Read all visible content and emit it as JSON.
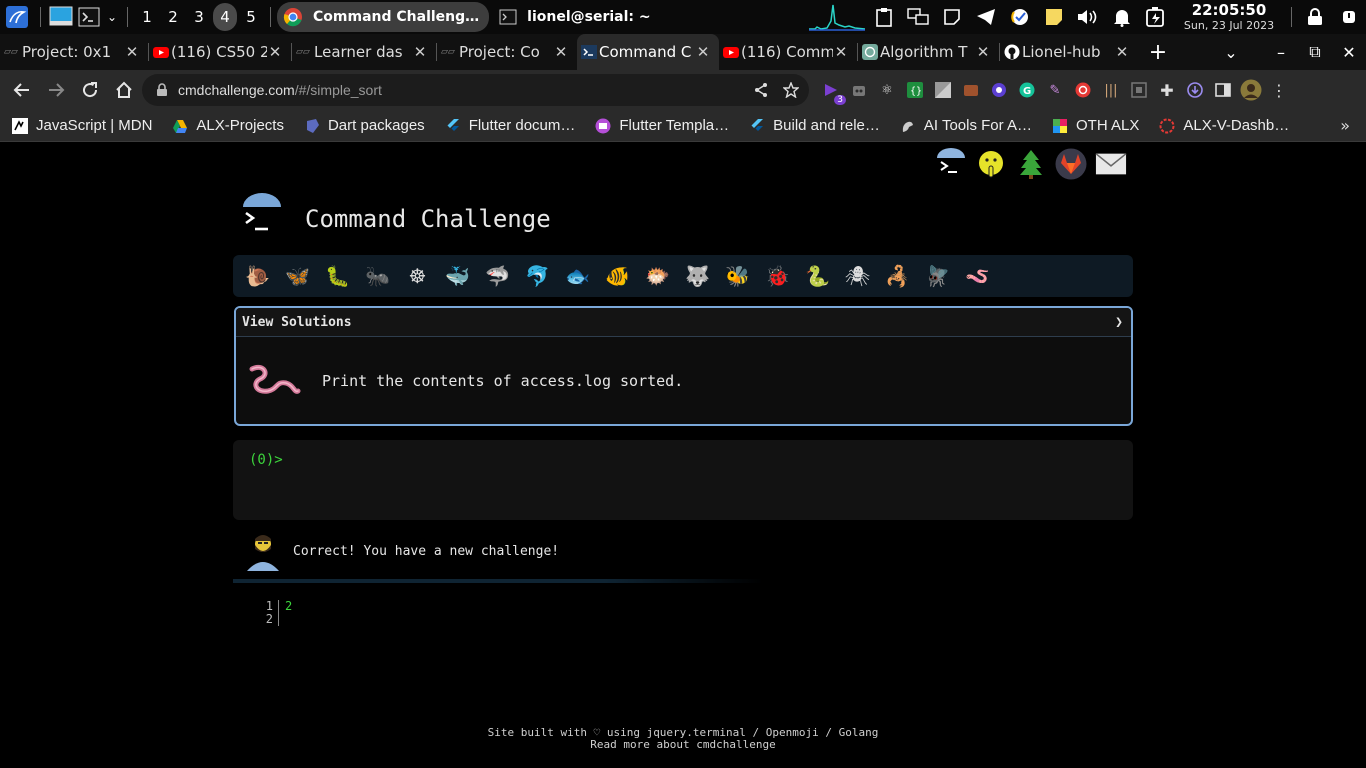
{
  "taskbar": {
    "workspaces": [
      "1",
      "2",
      "3",
      "4",
      "5"
    ],
    "active_workspace": "4",
    "apps": [
      {
        "label": "Command Challeng…",
        "icon": "chrome-icon"
      },
      {
        "label": "lionel@serial: ~",
        "icon": "terminal-icon"
      }
    ],
    "clock_time": "22:05:50",
    "clock_date": "Sun, 23 Jul 2023"
  },
  "tabs": [
    {
      "title": "Project: 0x1",
      "icon": "alx-icon"
    },
    {
      "title": "(116) CS50 2",
      "icon": "youtube-icon"
    },
    {
      "title": "Learner das",
      "icon": "alx-icon"
    },
    {
      "title": "Project: Co",
      "icon": "alx-icon"
    },
    {
      "title": "Command C",
      "icon": "terminal-icon"
    },
    {
      "title": "(116) Comm",
      "icon": "youtube-icon"
    },
    {
      "title": "Algorithm T",
      "icon": "openai-icon"
    },
    {
      "title": "Lionel-hub",
      "icon": "github-icon"
    }
  ],
  "address": {
    "host": "cmdchallenge.com",
    "path": "/#/simple_sort",
    "extension_badge": "3"
  },
  "bookmarks": [
    {
      "label": "JavaScript | MDN",
      "color": "#ffffff"
    },
    {
      "label": "ALX-Projects",
      "color": "#f4b400"
    },
    {
      "label": "Dart packages",
      "color": "#5c6bc0"
    },
    {
      "label": "Flutter docum…",
      "color": "#54c5f8"
    },
    {
      "label": "Flutter Templa…",
      "color": "#b54fd8"
    },
    {
      "label": "Build and rele…",
      "color": "#54c5f8"
    },
    {
      "label": "AI Tools For A…",
      "color": "#cccccc"
    },
    {
      "label": "OTH ALX",
      "color": "#4caf50"
    },
    {
      "label": "ALX-V-Dashb…",
      "color": "#e53935"
    }
  ],
  "page": {
    "title": "Command Challenge",
    "panel_header": "View Solutions",
    "panel_chevron": "❯",
    "challenge_text": "Print the contents of access.log sorted.",
    "prompt": "(0)>",
    "result_message": "Correct! You have a new challenge!",
    "output_lines": [
      {
        "num": "1",
        "code": "2"
      },
      {
        "num": "2",
        "code": ""
      }
    ],
    "footer_line1": "Site built with ♡ using jquery.terminal / Openmoji / Golang",
    "footer_line2": "Read more about cmdchallenge"
  },
  "critters": [
    {
      "glyph": "🐌",
      "name": "snail"
    },
    {
      "glyph": "🦋",
      "name": "butterfly"
    },
    {
      "glyph": "🐛",
      "name": "caterpillar"
    },
    {
      "glyph": "🐜",
      "name": "ant"
    },
    {
      "glyph": "☸",
      "name": "wheel"
    },
    {
      "glyph": "🐳",
      "name": "whale"
    },
    {
      "glyph": "🦈",
      "name": "shark"
    },
    {
      "glyph": "🐬",
      "name": "dolphin"
    },
    {
      "glyph": "🐟",
      "name": "fish"
    },
    {
      "glyph": "🐠",
      "name": "tropical-fish"
    },
    {
      "glyph": "🐡",
      "name": "blowfish"
    },
    {
      "glyph": "🐺",
      "name": "wolf"
    },
    {
      "glyph": "🐝",
      "name": "bee"
    },
    {
      "glyph": "🐞",
      "name": "ladybug"
    },
    {
      "glyph": "🐍",
      "name": "snake"
    },
    {
      "glyph": "🕷",
      "name": "spider"
    },
    {
      "glyph": "🦂",
      "name": "scorpion"
    },
    {
      "glyph": "🪰",
      "name": "fly"
    },
    {
      "glyph": "🪱",
      "name": "worm"
    }
  ],
  "colors": {
    "accent_green": "#3cd43c",
    "panel_border": "#7aa7d8"
  }
}
